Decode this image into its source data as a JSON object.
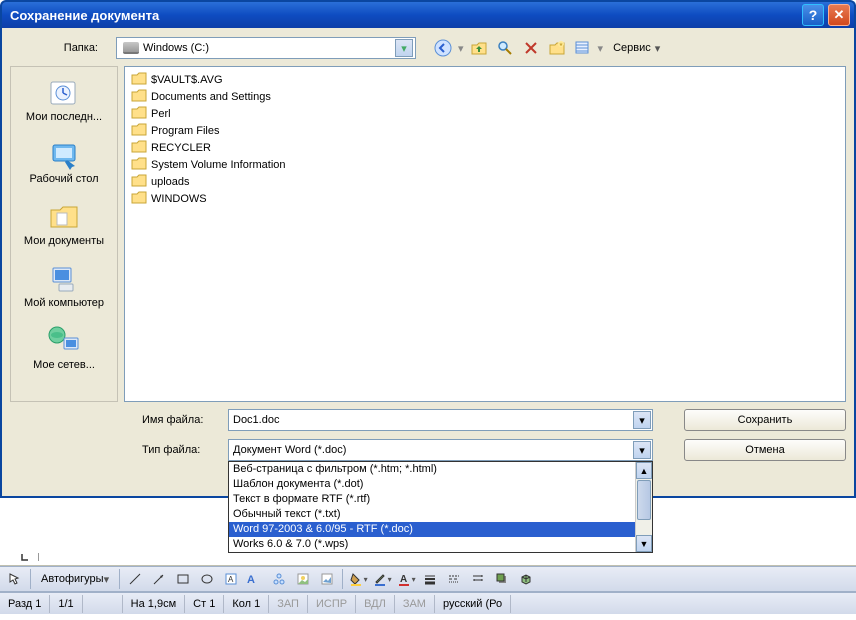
{
  "title": "Сохранение документа",
  "labels": {
    "folder": "Папка:",
    "filename": "Имя файла:",
    "filetype": "Тип файла:"
  },
  "folderCombo": {
    "text": "Windows (C:)"
  },
  "toolbarIcons": [
    "back",
    "up",
    "search",
    "delete",
    "new-folder",
    "views"
  ],
  "serviceButton": "Сервис",
  "places": [
    {
      "id": "recent",
      "label": "Мои последн..."
    },
    {
      "id": "desktop",
      "label": "Рабочий стол"
    },
    {
      "id": "mydocs",
      "label": "Мои документы"
    },
    {
      "id": "mycomputer",
      "label": "Мой компьютер"
    },
    {
      "id": "network",
      "label": "Мое сетев..."
    }
  ],
  "files": [
    "$VAULT$.AVG",
    "Documents and Settings",
    "Perl",
    "Program Files",
    "RECYCLER",
    "System Volume Information",
    "uploads",
    "WINDOWS"
  ],
  "filenameValue": "Doc1.doc",
  "filetypeValue": "Документ Word (*.doc)",
  "filetypeOptions": [
    {
      "text": "Веб-страница с фильтром (*.htm; *.html)",
      "selected": false
    },
    {
      "text": "Шаблон документа (*.dot)",
      "selected": false
    },
    {
      "text": "Текст в формате RTF (*.rtf)",
      "selected": false
    },
    {
      "text": "Обычный текст (*.txt)",
      "selected": false
    },
    {
      "text": "Word 97-2003 & 6.0/95 - RTF (*.doc)",
      "selected": true
    },
    {
      "text": "Works 6.0 & 7.0 (*.wps)",
      "selected": false
    }
  ],
  "buttons": {
    "save": "Сохранить",
    "cancel": "Отмена"
  },
  "drawingToolbar": {
    "autoshapes": "Автофигуры"
  },
  "statusbar": {
    "section": "Разд 1",
    "pages": "1/1",
    "at": "На 1,9см",
    "line": "Ст 1",
    "col": "Кол 1",
    "rec": "ЗАП",
    "fix": "ИСПР",
    "ext": "ВДЛ",
    "ovr": "ЗАМ",
    "lang": "русский (Ро"
  }
}
